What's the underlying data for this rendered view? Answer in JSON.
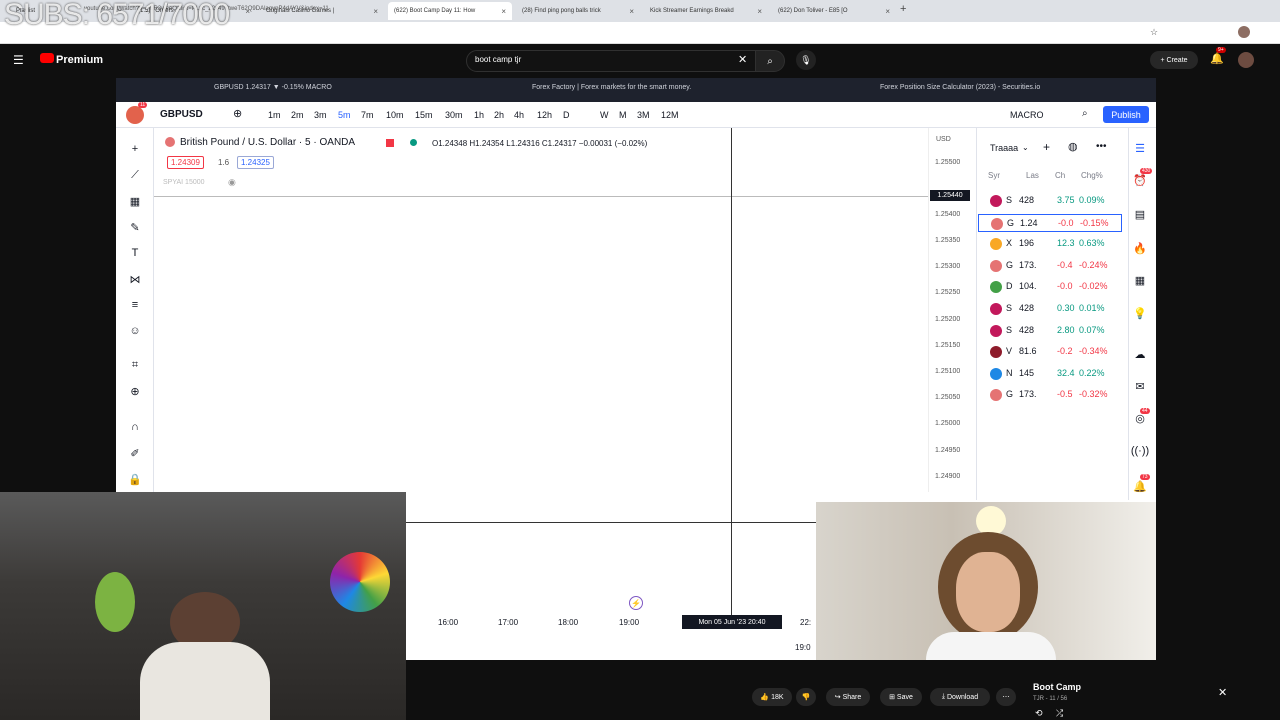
{
  "overlay": {
    "subs_text": "SUBS: 6571/7000"
  },
  "browser": {
    "tabs": [
      "Playlist",
      "(1.5) | Orders",
      "Originals Casino Games |",
      "(622) Boot Camp Day 11: How",
      "(28) Find ping pong balls trick",
      "Kick Streamer Earnings Breakd",
      "(622) Don Toliver - E85 [O"
    ],
    "url": "youtube.com/watch?v=_jLR3weeQ&list=PLxc_22x497tweT62Q9DAlagynP4dAYV&index=11"
  },
  "youtube": {
    "brand": "Premium",
    "search_query": "boot camp tjr",
    "create_label": "Create",
    "notification_badge": "9+"
  },
  "embed_tabs": [
    "GBPUSD 1.24317 ▼ -0.15% MACRO",
    "Forex Factory | Forex markets for the smart money.",
    "Forex Position Size Calculator (2023) - Securities.io"
  ],
  "tradingview": {
    "symbol": "GBPUSD",
    "avatar_badge": "11",
    "timeframes": [
      "1m",
      "2m",
      "3m",
      "5m",
      "7m",
      "10m",
      "15m",
      "30m",
      "1h",
      "2h",
      "4h",
      "12h",
      "D",
      "W",
      "M",
      "3M",
      "12M"
    ],
    "active_timeframe": "5m",
    "layout_name": "MACRO",
    "publish_label": "Publish",
    "chart_title": "British Pound / U.S. Dollar · 5 · OANDA",
    "ohlc": "O1.24348 H1.24354 L1.24316 C1.24317 −0.00031 (−0.02%)",
    "bid": "1.24309",
    "spread": "1.6",
    "ask": "1.24325",
    "indicator_label": "SPYAI 15000",
    "currency": "USD",
    "price_levels": [
      "1.25500",
      "1.25400",
      "1.25350",
      "1.25300",
      "1.25250",
      "1.25200",
      "1.25150",
      "1.25100",
      "1.25050",
      "1.25000",
      "1.24950",
      "1.24900"
    ],
    "crosshair_price": "1.25440",
    "time_labels": [
      "16:00",
      "17:00",
      "18:00",
      "19:00",
      "22:"
    ],
    "crosshair_time": "Mon 05 Jun '23  20:40",
    "bottom_label": "19:0",
    "watchlist": {
      "title": "Traaaa",
      "columns": [
        "Syr",
        "Las",
        "Ch",
        "Chg%"
      ],
      "rows": [
        {
          "sym": "S",
          "last": "428",
          "ch": "3.75",
          "chp": "0.09%",
          "color": "#c2185b",
          "up": true
        },
        {
          "sym": "G",
          "last": "1.24",
          "ch": "-0.0",
          "chp": "-0.15%",
          "color": "#e57373",
          "up": false
        },
        {
          "sym": "X",
          "last": "196",
          "ch": "12.3",
          "chp": "0.63%",
          "color": "#f9a825",
          "up": true
        },
        {
          "sym": "G",
          "last": "173.",
          "ch": "-0.4",
          "chp": "-0.24%",
          "color": "#e57373",
          "up": false
        },
        {
          "sym": "D",
          "last": "104.",
          "ch": "-0.0",
          "chp": "-0.02%",
          "color": "#43a047",
          "up": false
        },
        {
          "sym": "S",
          "last": "428",
          "ch": "0.30",
          "chp": "0.01%",
          "color": "#c2185b",
          "up": true
        },
        {
          "sym": "S",
          "last": "428",
          "ch": "2.80",
          "chp": "0.07%",
          "color": "#c2185b",
          "up": true
        },
        {
          "sym": "V",
          "last": "81.6",
          "ch": "-0.2",
          "chp": "-0.34%",
          "color": "#8e1b2b",
          "up": false
        },
        {
          "sym": "N",
          "last": "145",
          "ch": "32.4",
          "chp": "0.22%",
          "color": "#1e88e5",
          "up": true
        },
        {
          "sym": "G",
          "last": "173.",
          "ch": "-0.5",
          "chp": "-0.32%",
          "color": "#e57373",
          "up": false
        }
      ]
    },
    "right_badges": [
      "430",
      "44",
      "73"
    ],
    "up_color": "#089981",
    "down_color": "#f23645"
  },
  "player": {
    "likes": "18K",
    "share_label": "Share",
    "save_label": "Save",
    "download_label": "Download",
    "playlist_title": "Boot Camp",
    "playlist_sub": "TJR - 11 / 56"
  }
}
